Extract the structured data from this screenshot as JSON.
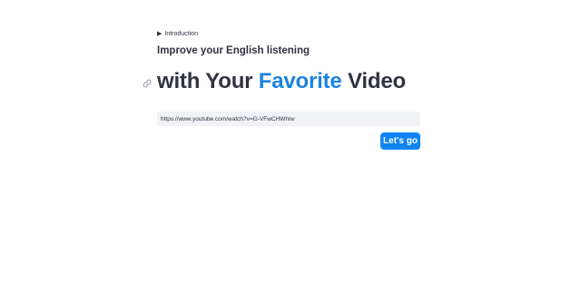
{
  "intro": {
    "toggle_icon": "caret-right-icon",
    "label": "Introduction"
  },
  "subtitle": "Improve your English listening",
  "heading": {
    "part1": "with Your ",
    "accent": "Favorite",
    "part2": " Video",
    "accent_color": "#1c83e1",
    "anchor_icon": "link-icon"
  },
  "url_input": {
    "value": "https://www.youtube.com/watch?v=G-VFwCHWhIw"
  },
  "go_button": {
    "label": "Let's go",
    "color": "#0f84f5"
  }
}
